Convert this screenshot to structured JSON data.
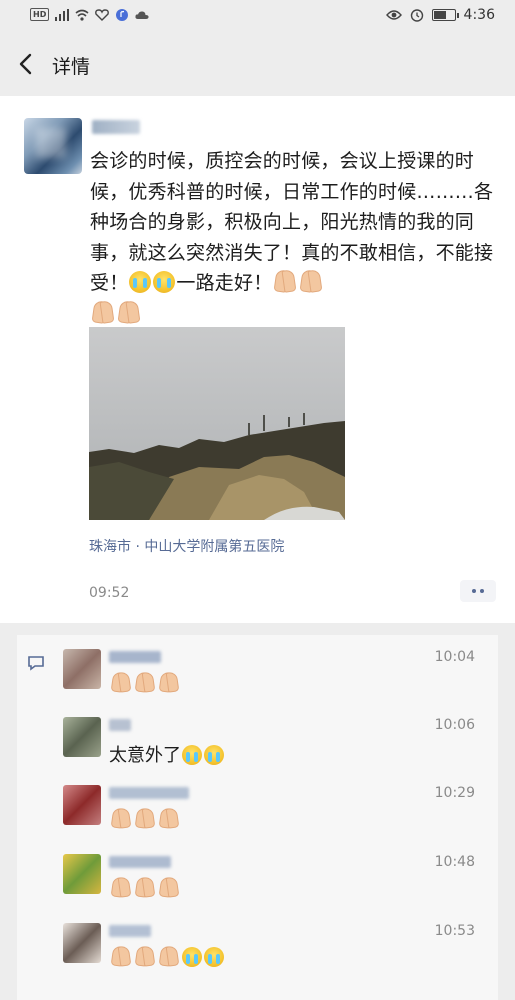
{
  "status_bar": {
    "network": "HD",
    "time": "4:36"
  },
  "nav": {
    "title": "详情"
  },
  "post": {
    "text_main": "会诊的时候，质控会的时候，会议上授课的时候，优秀科普的时候，日常工作的时候………各种场合的身影，积极向上，阳光热情的我的同事，就这么突然消失了！真的不敢相信，不能接受！",
    "text_tail": "一路走好！",
    "emoji_sequence": [
      "crying-face",
      "crying-face",
      "folded-hands",
      "folded-hands",
      "folded-hands",
      "folded-hands"
    ],
    "location": "珠海市 · 中山大学附属第五医院",
    "time": "09:52"
  },
  "comments": [
    {
      "time": "10:04",
      "text": "",
      "emojis": [
        "folded-hands",
        "folded-hands",
        "folded-hands"
      ]
    },
    {
      "time": "10:06",
      "text": "太意外了",
      "emojis": [
        "crying-face",
        "crying-face"
      ]
    },
    {
      "time": "10:29",
      "text": "",
      "emojis": [
        "folded-hands",
        "folded-hands",
        "folded-hands"
      ]
    },
    {
      "time": "10:48",
      "text": "",
      "emojis": [
        "folded-hands",
        "folded-hands",
        "folded-hands"
      ]
    },
    {
      "time": "10:53",
      "text": "",
      "emojis": [
        "folded-hands",
        "folded-hands",
        "folded-hands",
        "crying-face",
        "crying-face"
      ]
    }
  ],
  "colors": {
    "link": "#576b95",
    "background": "#ededed",
    "timestamp": "#8a8a8a"
  }
}
